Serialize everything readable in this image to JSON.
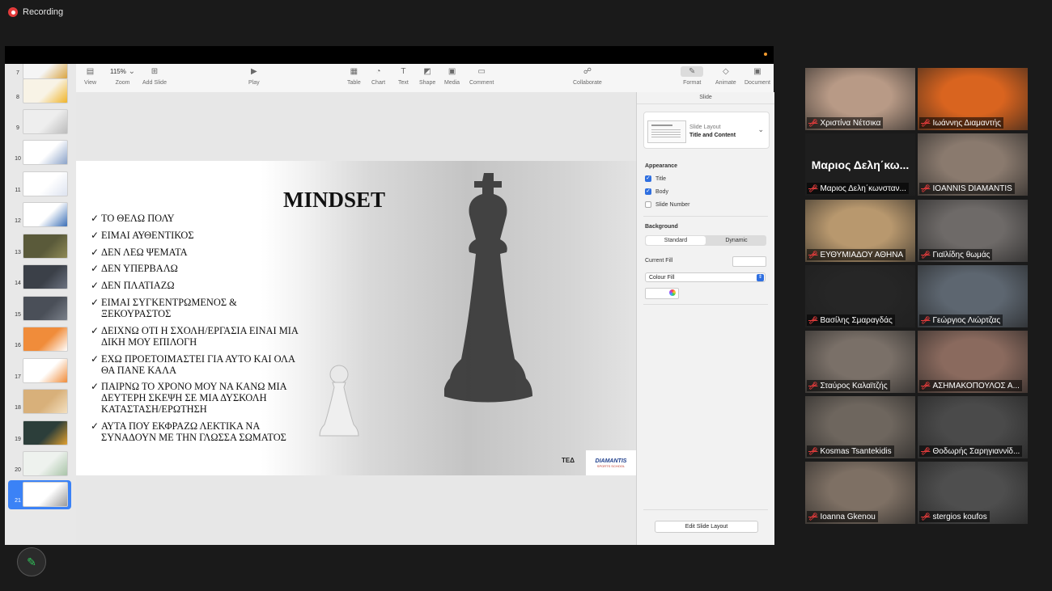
{
  "recording": {
    "label": "Recording"
  },
  "toolbar": {
    "view": "View",
    "zoom_value": "115%",
    "zoom": "Zoom",
    "add_slide": "Add Slide",
    "play": "Play",
    "table": "Table",
    "chart": "Chart",
    "text": "Text",
    "shape": "Shape",
    "media": "Media",
    "comment": "Comment",
    "collaborate": "Collaborate",
    "format": "Format",
    "animate": "Animate",
    "document": "Document"
  },
  "navigator": {
    "slides": [
      {
        "num": "7",
        "colors": [
          "#f5f5f5",
          "#d9a441"
        ]
      },
      {
        "num": "8",
        "colors": [
          "#f8f3e6",
          "#f0b429"
        ]
      },
      {
        "num": "9",
        "colors": [
          "#eeeeee",
          "#bbbbbb"
        ]
      },
      {
        "num": "10",
        "colors": [
          "#ffffff",
          "#8aa2c8"
        ]
      },
      {
        "num": "11",
        "colors": [
          "#ffffff",
          "#dde3f0"
        ]
      },
      {
        "num": "12",
        "colors": [
          "#ffffff",
          "#3b6fb6"
        ]
      },
      {
        "num": "13",
        "colors": [
          "#5a5a3a",
          "#8f8a55"
        ]
      },
      {
        "num": "14",
        "colors": [
          "#3b4048",
          "#6b7280"
        ]
      },
      {
        "num": "15",
        "colors": [
          "#4a4f58",
          "#7a808a"
        ]
      },
      {
        "num": "16",
        "colors": [
          "#f08c3a",
          "#ffffff"
        ]
      },
      {
        "num": "17",
        "colors": [
          "#ffffff",
          "#f08c3a"
        ]
      },
      {
        "num": "18",
        "colors": [
          "#d8b07a",
          "#f3e0c0"
        ]
      },
      {
        "num": "19",
        "colors": [
          "#2c3e3a",
          "#e0a030"
        ]
      },
      {
        "num": "20",
        "colors": [
          "#eef2ee",
          "#a9c4a8"
        ]
      },
      {
        "num": "21",
        "colors": [
          "#ffffff",
          "#9a9a9a"
        ]
      }
    ],
    "selected": "21"
  },
  "slide": {
    "title": "MINDSET",
    "bullets": [
      "ΤΟ ΘΕΛΩ ΠΟΛΥ",
      "ΕΙΜΑΙ ΑΥΘΕΝΤΙΚΟΣ",
      "ΔΕΝ ΛΕΩ ΨΕΜΑΤΑ",
      "ΔΕΝ ΥΠΕΡΒΑΛΩ",
      "ΔΕΝ ΠΛΑΤΙΑΖΩ",
      "ΕΙΜΑΙ ΣΥΓΚΕΝΤΡΩΜΕΝΟΣ & ΞΕΚΟΥΡΑΣΤΟΣ",
      "ΔΕΙΧΝΩ ΟΤΙ Η ΣΧΟΛΗ/ΕΡΓΑΣΙΑ ΕΙΝΑΙ ΜΙΑ ΔΙΚΗ ΜΟΥ ΕΠΙΛΟΓΗ",
      "ΕΧΩ ΠΡΟΕΤΟΙΜΑΣΤΕΙ ΓΙΑ ΑΥΤΟ ΚΑΙ ΟΛΑ ΘΑ ΠΑΝΕ ΚΑΛΑ",
      "ΠΑΙΡΝΩ ΤΟ ΧΡΟΝΟ ΜΟΥ ΝΑ ΚΑΝΩ ΜΙΑ ΔΕΥΤΕΡΗ ΣΚΕΨΗ ΣΕ ΜΙΑ ΔΥΣΚΟΛΗ ΚΑΤΑΣΤΑΣΗ/ΕΡΩΤΗΣΗ",
      "ΑΥΤΑ ΠΟΥ ΕΚΦΡΑΖΩ ΛΕΚΤΙΚΑ ΝΑ ΣΥΝΑΔΟΥΝ ΜΕ ΤΗΝ ΓΛΩΣΣΑ ΣΩΜΑΤΟΣ"
    ],
    "logo_text": "ΤΕΔ",
    "brand": "DIAMANTIS",
    "brand_sub": "SPORTS SCHOOL"
  },
  "inspector": {
    "header": "Slide",
    "layout_label": "Slide Layout",
    "layout_name": "Title and Content",
    "appearance": "Appearance",
    "title_cb": "Title",
    "body_cb": "Body",
    "slide_number_cb": "Slide Number",
    "background": "Background",
    "standard": "Standard",
    "dynamic": "Dynamic",
    "current_fill": "Current Fill",
    "colour_fill": "Colour Fill",
    "edit_layout": "Edit Slide Layout"
  },
  "participants": [
    {
      "name": "Χριστίνα Νέτσικα",
      "bg": "#b89a86"
    },
    {
      "name": "Ιωάννης Διαμαντής",
      "bg": "#d9641f"
    },
    {
      "name": "Μαριος Δελη΄κωνσταν...",
      "bg": "#1e1e1e",
      "big": "Μαριος Δελη΄κω..."
    },
    {
      "name": "IOANNIS DIAMANTIS",
      "bg": "#8a7a6e",
      "active": true
    },
    {
      "name": "ΕΥΘΥΜΙΑΔΟΥ ΑΘΗΝΑ",
      "bg": "#b8986e"
    },
    {
      "name": "Γιαϊλίδης θωμάς",
      "bg": "#6e6a68"
    },
    {
      "name": "Βασίλης Σμαραγδάς",
      "bg": "#262626"
    },
    {
      "name": "Γεώργιος Λιώρτζας",
      "bg": "#5d6670"
    },
    {
      "name": "Σταύρος Καλαϊτζής",
      "bg": "#7a7068"
    },
    {
      "name": "ΑΣΗΜΑΚΟΠΟΥΛΟΣ Α...",
      "bg": "#8a6a5e"
    },
    {
      "name": "Kosmas Tsantekidis",
      "bg": "#6e665e"
    },
    {
      "name": "Θοδωρής Σαρηγιαννίδ...",
      "bg": "#4a4a4a"
    },
    {
      "name": "Ioanna Gkenou",
      "bg": "#7e7064"
    },
    {
      "name": "stergios koufos",
      "bg": "#4e4e4e"
    }
  ]
}
